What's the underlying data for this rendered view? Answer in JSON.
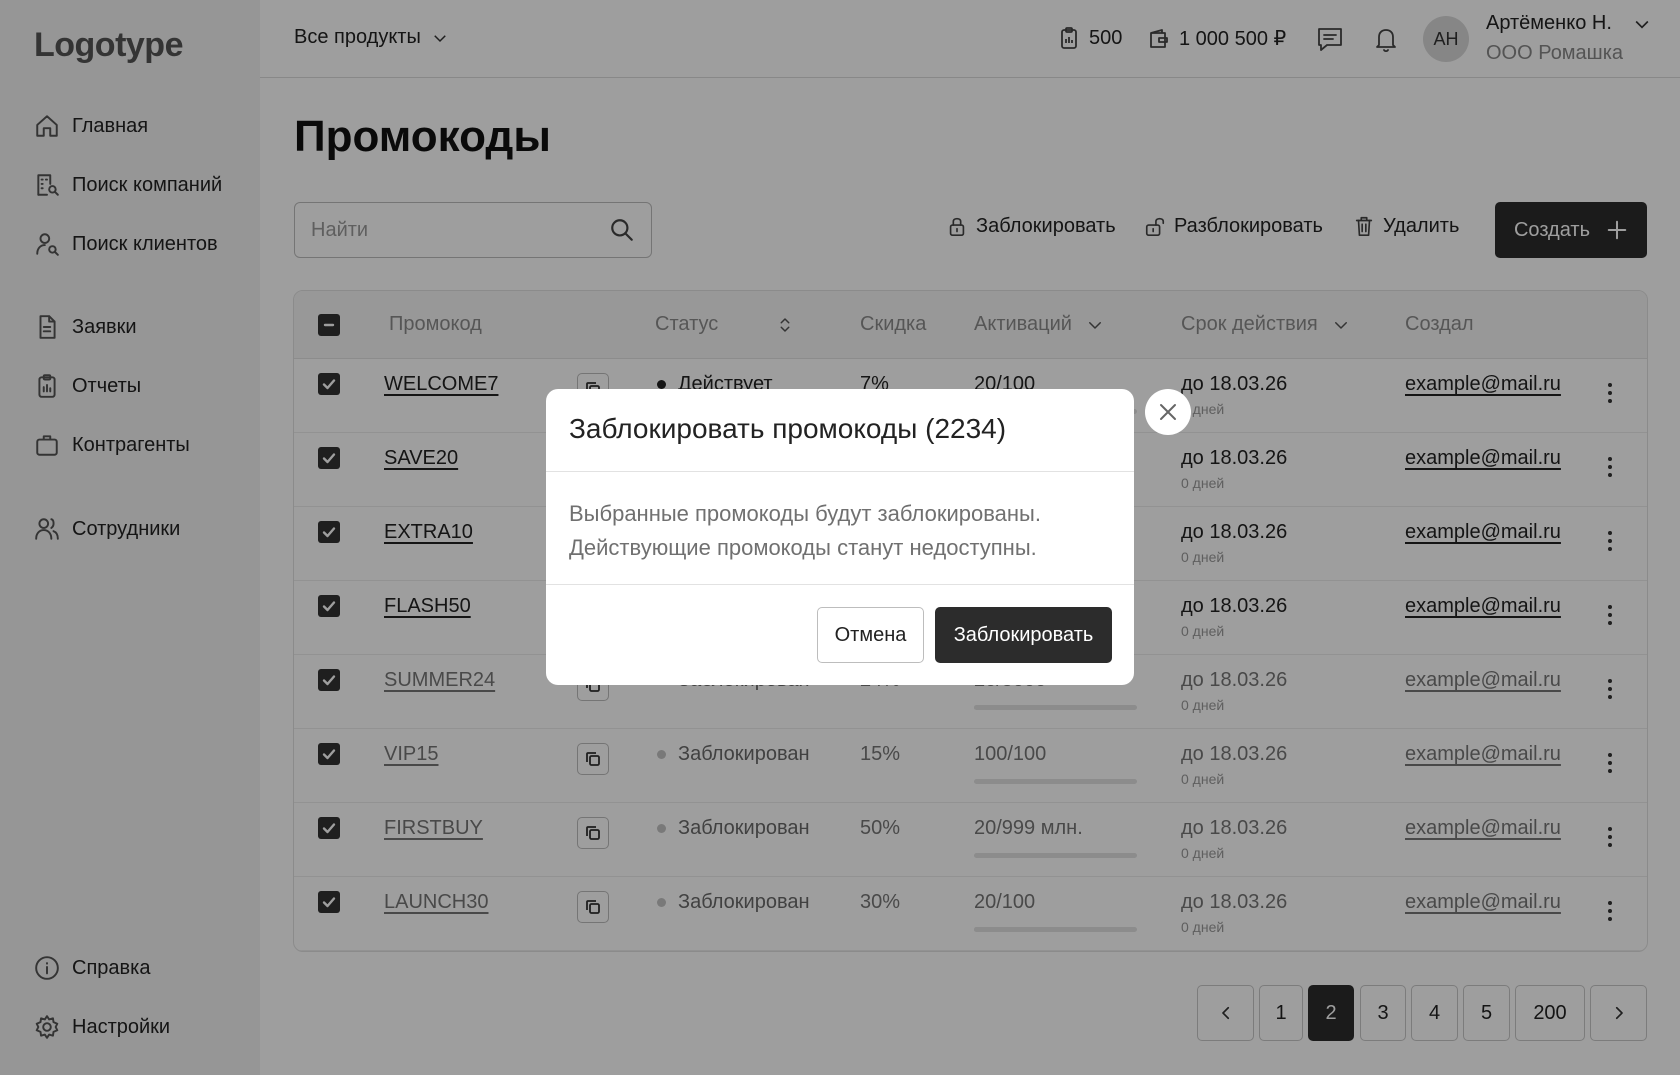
{
  "app": {
    "logo": "Logotype"
  },
  "sidebar": {
    "items": [
      {
        "label": "Главная",
        "icon": "home-icon"
      },
      {
        "label": "Поиск компаний",
        "icon": "building-search-icon"
      },
      {
        "label": "Поиск клиентов",
        "icon": "user-search-icon"
      },
      {
        "label": "Заявки",
        "icon": "document-icon"
      },
      {
        "label": "Отчеты",
        "icon": "clipboard-icon"
      },
      {
        "label": "Контрагенты",
        "icon": "briefcase-icon"
      },
      {
        "label": "Сотрудники",
        "icon": "users-icon"
      }
    ],
    "bottom": [
      {
        "label": "Справка",
        "icon": "info-icon"
      },
      {
        "label": "Настройки",
        "icon": "gear-icon"
      }
    ]
  },
  "topbar": {
    "product_select": "Все продукты",
    "count_value": "500",
    "balance_value": "1 000 500 ₽",
    "user": {
      "initials": "АН",
      "name": "Артёменко Н.",
      "org": "ООО Ромашка"
    }
  },
  "page": {
    "title": "Промокоды",
    "search_placeholder": "Найти",
    "actions": {
      "block": "Заблокировать",
      "unblock": "Разблокировать",
      "delete": "Удалить",
      "create": "Создать"
    }
  },
  "table": {
    "headers": {
      "code": "Промокод",
      "status": "Статус",
      "discount": "Скидка",
      "activations": "Активаций",
      "expiry": "Срок действия",
      "creator": "Создал"
    },
    "rows": [
      {
        "code": "WELCOME7",
        "status": "Действует",
        "blocked": false,
        "discount": "7%",
        "activations": "20/100",
        "progress": 0.2,
        "expiry": "до 18.03.26",
        "expiry_sub": "0 дней",
        "creator": "example@mail.ru"
      },
      {
        "code": "SAVE20",
        "status": "",
        "blocked": false,
        "discount": "",
        "activations": "",
        "progress": 0,
        "expiry": "до 18.03.26",
        "expiry_sub": "0 дней",
        "creator": "example@mail.ru"
      },
      {
        "code": "EXTRA10",
        "status": "",
        "blocked": false,
        "discount": "",
        "activations": "",
        "progress": 0,
        "expiry": "до 18.03.26",
        "expiry_sub": "0 дней",
        "creator": "example@mail.ru"
      },
      {
        "code": "FLASH50",
        "status": "",
        "blocked": false,
        "discount": "",
        "activations": "",
        "progress": 0,
        "expiry": "до 18.03.26",
        "expiry_sub": "0 дней",
        "creator": "example@mail.ru"
      },
      {
        "code": "SUMMER24",
        "status": "Заблокирован",
        "blocked": true,
        "discount": "24%",
        "activations": "20/5000",
        "progress": 0.004,
        "expiry": "до 18.03.26",
        "expiry_sub": "0 дней",
        "creator": "example@mail.ru"
      },
      {
        "code": "VIP15",
        "status": "Заблокирован",
        "blocked": true,
        "discount": "15%",
        "activations": "100/100",
        "progress": 1.0,
        "expiry": "до 18.03.26",
        "expiry_sub": "0 дней",
        "creator": "example@mail.ru"
      },
      {
        "code": "FIRSTBUY",
        "status": "Заблокирован",
        "blocked": true,
        "discount": "50%",
        "activations": "20/999 млн.",
        "progress": 0.0,
        "expiry": "до 18.03.26",
        "expiry_sub": "0 дней",
        "creator": "example@mail.ru"
      },
      {
        "code": "LAUNCH30",
        "status": "Заблокирован",
        "blocked": true,
        "discount": "30%",
        "activations": "20/100",
        "progress": 0.2,
        "expiry": "до 18.03.26",
        "expiry_sub": "0 дней",
        "creator": "example@mail.ru"
      }
    ]
  },
  "pagination": {
    "pages": [
      "1",
      "2",
      "3",
      "4",
      "5",
      "200"
    ],
    "current": "2"
  },
  "modal": {
    "title": "Заблокировать промокоды (2234)",
    "body_line1": "Выбранные промокоды будут заблокированы.",
    "body_line2": "Действующие промокоды станут недоступны.",
    "cancel": "Отмена",
    "confirm": "Заблокировать"
  }
}
